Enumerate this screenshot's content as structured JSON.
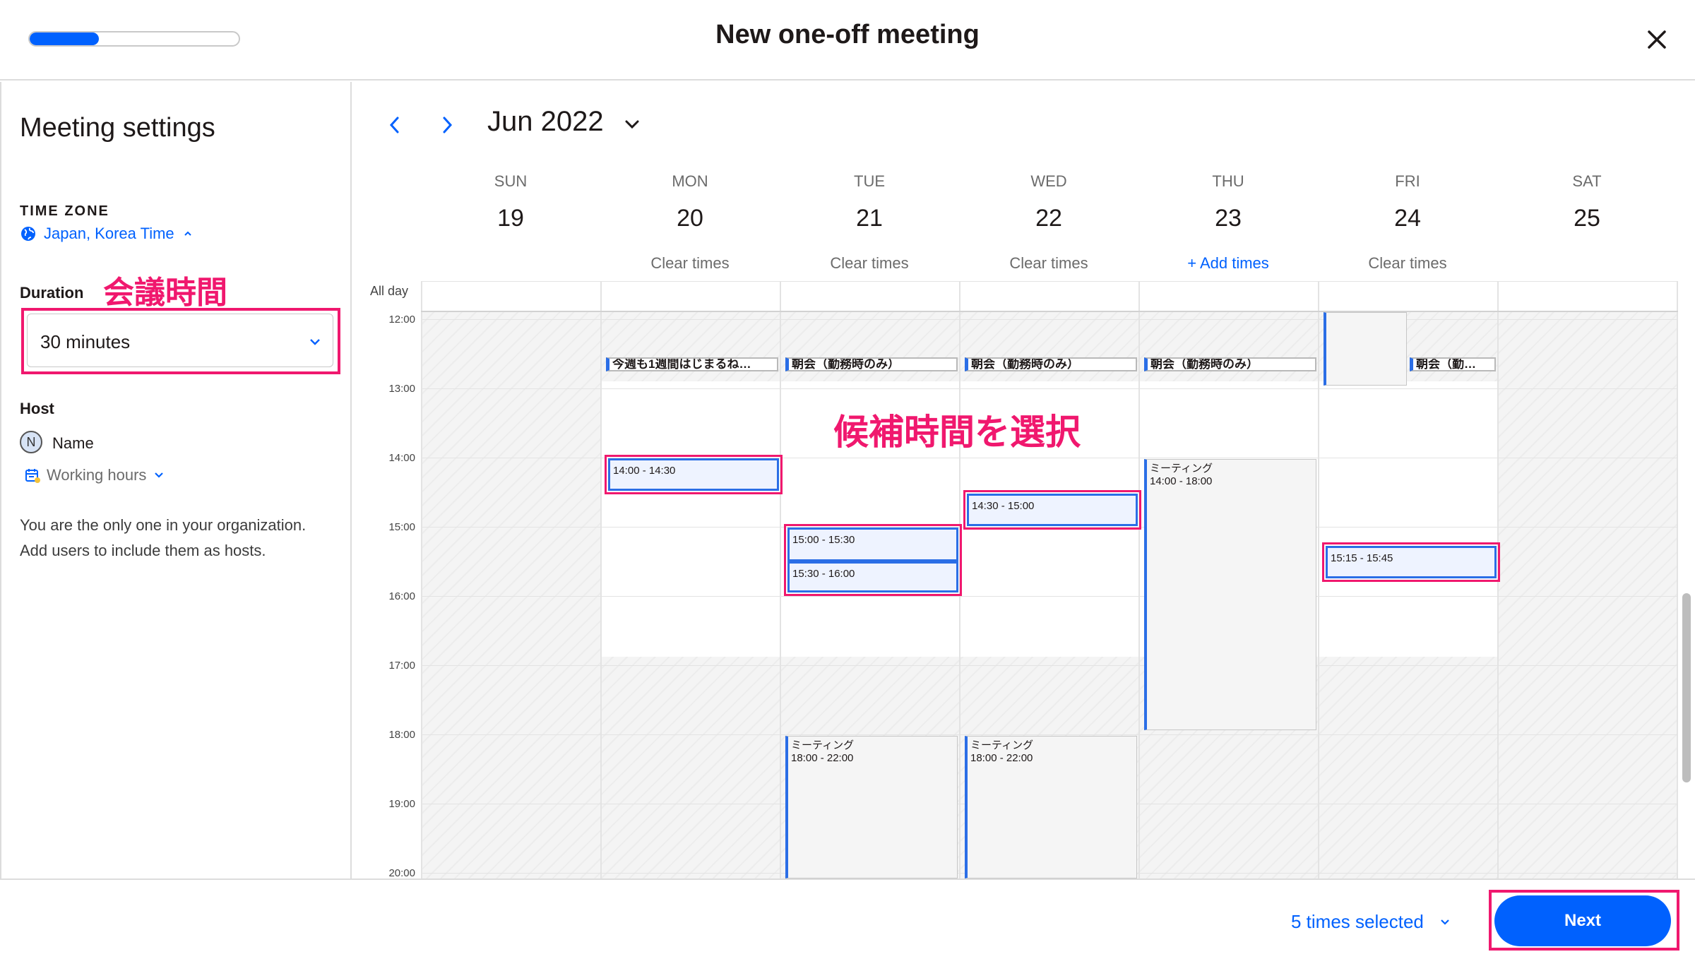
{
  "header": {
    "title": "New one-off meeting",
    "progress": 0.33
  },
  "sidebar": {
    "title": "Meeting settings",
    "timezone_label": "TIME ZONE",
    "timezone_value": "Japan, Korea Time",
    "duration_label": "Duration",
    "duration_annotation": "会議時間",
    "duration_value": "30 minutes",
    "host_label": "Host",
    "host_initial": "N",
    "host_name": "Name",
    "working_hours": "Working hours",
    "note_line1": "You are the only one in your organization.",
    "note_line2": "Add users to include them as hosts."
  },
  "calendar": {
    "month": "Jun 2022",
    "days": [
      {
        "name": "SUN",
        "num": "19",
        "action": ""
      },
      {
        "name": "MON",
        "num": "20",
        "action": "Clear times"
      },
      {
        "name": "TUE",
        "num": "21",
        "action": "Clear times"
      },
      {
        "name": "WED",
        "num": "22",
        "action": "Clear times"
      },
      {
        "name": "THU",
        "num": "23",
        "action": "+ Add times"
      },
      {
        "name": "FRI",
        "num": "24",
        "action": "Clear times"
      },
      {
        "name": "SAT",
        "num": "25",
        "action": ""
      }
    ],
    "allday_label": "All day",
    "hours": [
      "12:00",
      "13:00",
      "14:00",
      "15:00",
      "16:00",
      "17:00",
      "18:00",
      "19:00",
      "20:00"
    ],
    "allday_events": [
      {
        "day": 1,
        "text": "今週も1週間はじまるね…"
      },
      {
        "day": 2,
        "text": "朝会（勤務時のみ）"
      },
      {
        "day": 3,
        "text": "朝会（勤務時のみ）"
      },
      {
        "day": 4,
        "text": "朝会（勤務時のみ）"
      },
      {
        "day": 5,
        "text": "朝会（勤…"
      }
    ],
    "events": [
      {
        "day": 4,
        "title": "ミーティング",
        "time": "14:00 - 18:00"
      },
      {
        "day": 2,
        "title": "ミーティング",
        "time": "18:00 - 22:00"
      },
      {
        "day": 3,
        "title": "ミーティング",
        "time": "18:00 - 22:00"
      }
    ],
    "slots": [
      {
        "day": 1,
        "text": "14:00 - 14:30"
      },
      {
        "day": 2,
        "text": "15:00 - 15:30"
      },
      {
        "day": 2,
        "text": "15:30 - 16:00"
      },
      {
        "day": 3,
        "text": "14:30 - 15:00"
      },
      {
        "day": 5,
        "text": "15:15 - 15:45"
      }
    ],
    "availability_annotation": "候補時間を選択"
  },
  "footer": {
    "times_selected": "5 times selected",
    "next_label": "Next"
  },
  "colors": {
    "accent": "#0061fe",
    "annotation": "#f0186e"
  }
}
